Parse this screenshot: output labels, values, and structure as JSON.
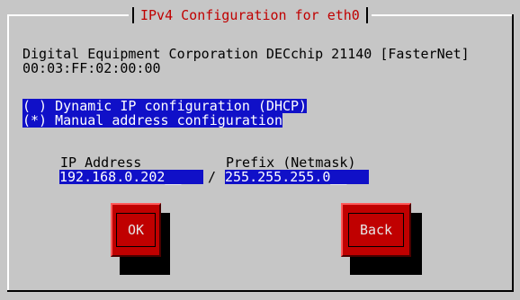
{
  "dialog": {
    "title": "IPv4 Configuration for eth0",
    "device_line1": "Digital Equipment Corporation DECchip 21140 [FasterNet]",
    "device_line2": "00:03:FF:02:00:00"
  },
  "options": [
    {
      "label": "( ) Dynamic IP configuration (DHCP)"
    },
    {
      "label": "(*) Manual address configuration"
    }
  ],
  "fields": {
    "ip_label": "IP Address",
    "ip_value": "192.168.0.202__",
    "prefix_label": "Prefix (Netmask)",
    "prefix_value": "255.255.255.0__",
    "separator": "/"
  },
  "buttons": {
    "ok": "OK",
    "back": "Back"
  },
  "colors": {
    "background": "#c6c6c6",
    "title": "#c00000",
    "selection": "#1010c8",
    "button": "#c00000"
  }
}
